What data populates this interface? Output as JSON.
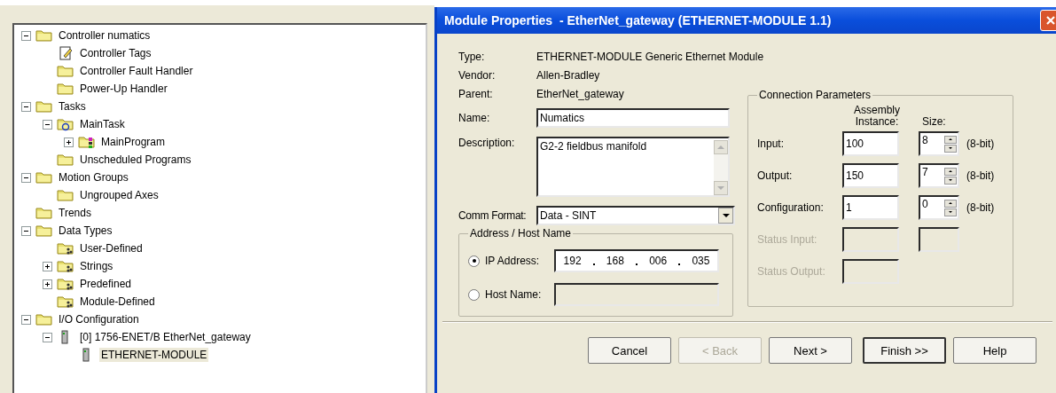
{
  "tree": [
    {
      "label": "Controller numatics",
      "kind": "folder",
      "expanded": true,
      "selected": false,
      "children": [
        {
          "label": "Controller Tags",
          "kind": "tags",
          "selected": false
        },
        {
          "label": "Controller Fault Handler",
          "kind": "folder",
          "selected": false
        },
        {
          "label": "Power-Up Handler",
          "kind": "folder",
          "selected": false
        }
      ]
    },
    {
      "label": "Tasks",
      "kind": "folder",
      "expanded": true,
      "selected": false,
      "children": [
        {
          "label": "MainTask",
          "kind": "task",
          "expanded": true,
          "selected": false,
          "children": [
            {
              "label": "MainProgram",
              "kind": "program",
              "expanded": false,
              "selected": false
            }
          ]
        },
        {
          "label": "Unscheduled Programs",
          "kind": "folder",
          "selected": false
        }
      ]
    },
    {
      "label": "Motion Groups",
      "kind": "folder",
      "expanded": true,
      "selected": false,
      "children": [
        {
          "label": "Ungrouped Axes",
          "kind": "folder",
          "selected": false
        }
      ]
    },
    {
      "label": "Trends",
      "kind": "folder",
      "selected": false
    },
    {
      "label": "Data Types",
      "kind": "folder",
      "expanded": true,
      "selected": false,
      "children": [
        {
          "label": "User-Defined",
          "kind": "datatype",
          "selected": false
        },
        {
          "label": "Strings",
          "kind": "datatype",
          "expanded": false,
          "selected": false
        },
        {
          "label": "Predefined",
          "kind": "datatype",
          "expanded": false,
          "selected": false
        },
        {
          "label": "Module-Defined",
          "kind": "datatype",
          "selected": false
        }
      ]
    },
    {
      "label": "I/O Configuration",
      "kind": "folder",
      "expanded": true,
      "selected": false,
      "children": [
        {
          "label": "[0] 1756-ENET/B EtherNet_gateway",
          "kind": "module",
          "expanded": true,
          "selected": false,
          "children": [
            {
              "label": "ETHERNET-MODULE",
              "kind": "module",
              "selected": true
            }
          ]
        }
      ]
    }
  ],
  "dialog": {
    "title": "Module Properties  - EtherNet_gateway (ETHERNET-MODULE 1.1)",
    "info": [
      {
        "label": "Type:",
        "value": "ETHERNET-MODULE Generic Ethernet Module"
      },
      {
        "label": "Vendor:",
        "value": "Allen-Bradley"
      },
      {
        "label": "Parent:",
        "value": "EtherNet_gateway"
      }
    ],
    "name": {
      "label": "Name:",
      "value": "Numatics"
    },
    "description": {
      "label": "Description:",
      "value": "G2-2 fieldbus manifold"
    },
    "comm_format": {
      "label": "Comm Format:",
      "value": "Data - SINT"
    },
    "address": {
      "title": "Address / Host Name",
      "options": [
        {
          "label": "IP Address:",
          "selected": true,
          "kind": "ip",
          "octets": [
            "192",
            "168",
            "006",
            "035"
          ]
        },
        {
          "label": "Host Name:",
          "selected": false,
          "kind": "host"
        }
      ]
    },
    "connection": {
      "title": "Connection Parameters",
      "instance_heading": "Assembly Instance:",
      "size_heading": "Size:",
      "rows": [
        {
          "kind": "full",
          "label": "Input:",
          "instance": "100",
          "size": "8",
          "unit": "(8-bit)",
          "disabled": false
        },
        {
          "kind": "full",
          "label": "Output:",
          "instance": "150",
          "size": "7",
          "unit": "(8-bit)",
          "disabled": false
        },
        {
          "kind": "full",
          "label": "Configuration:",
          "instance": "1",
          "size": "0",
          "unit": "(8-bit)",
          "disabled": false
        },
        {
          "kind": "pair",
          "label": "Status Input:",
          "disabled": true
        },
        {
          "kind": "single",
          "label": "Status Output:",
          "disabled": true
        }
      ]
    },
    "buttons": [
      {
        "label": "Cancel",
        "disabled": false,
        "default": false
      },
      {
        "label": "< Back",
        "disabled": true,
        "default": false
      },
      {
        "label": "Next >",
        "disabled": false,
        "default": false
      },
      {
        "label": "Finish >>",
        "disabled": false,
        "default": true
      },
      {
        "label": "Help",
        "disabled": false,
        "default": false
      }
    ]
  }
}
